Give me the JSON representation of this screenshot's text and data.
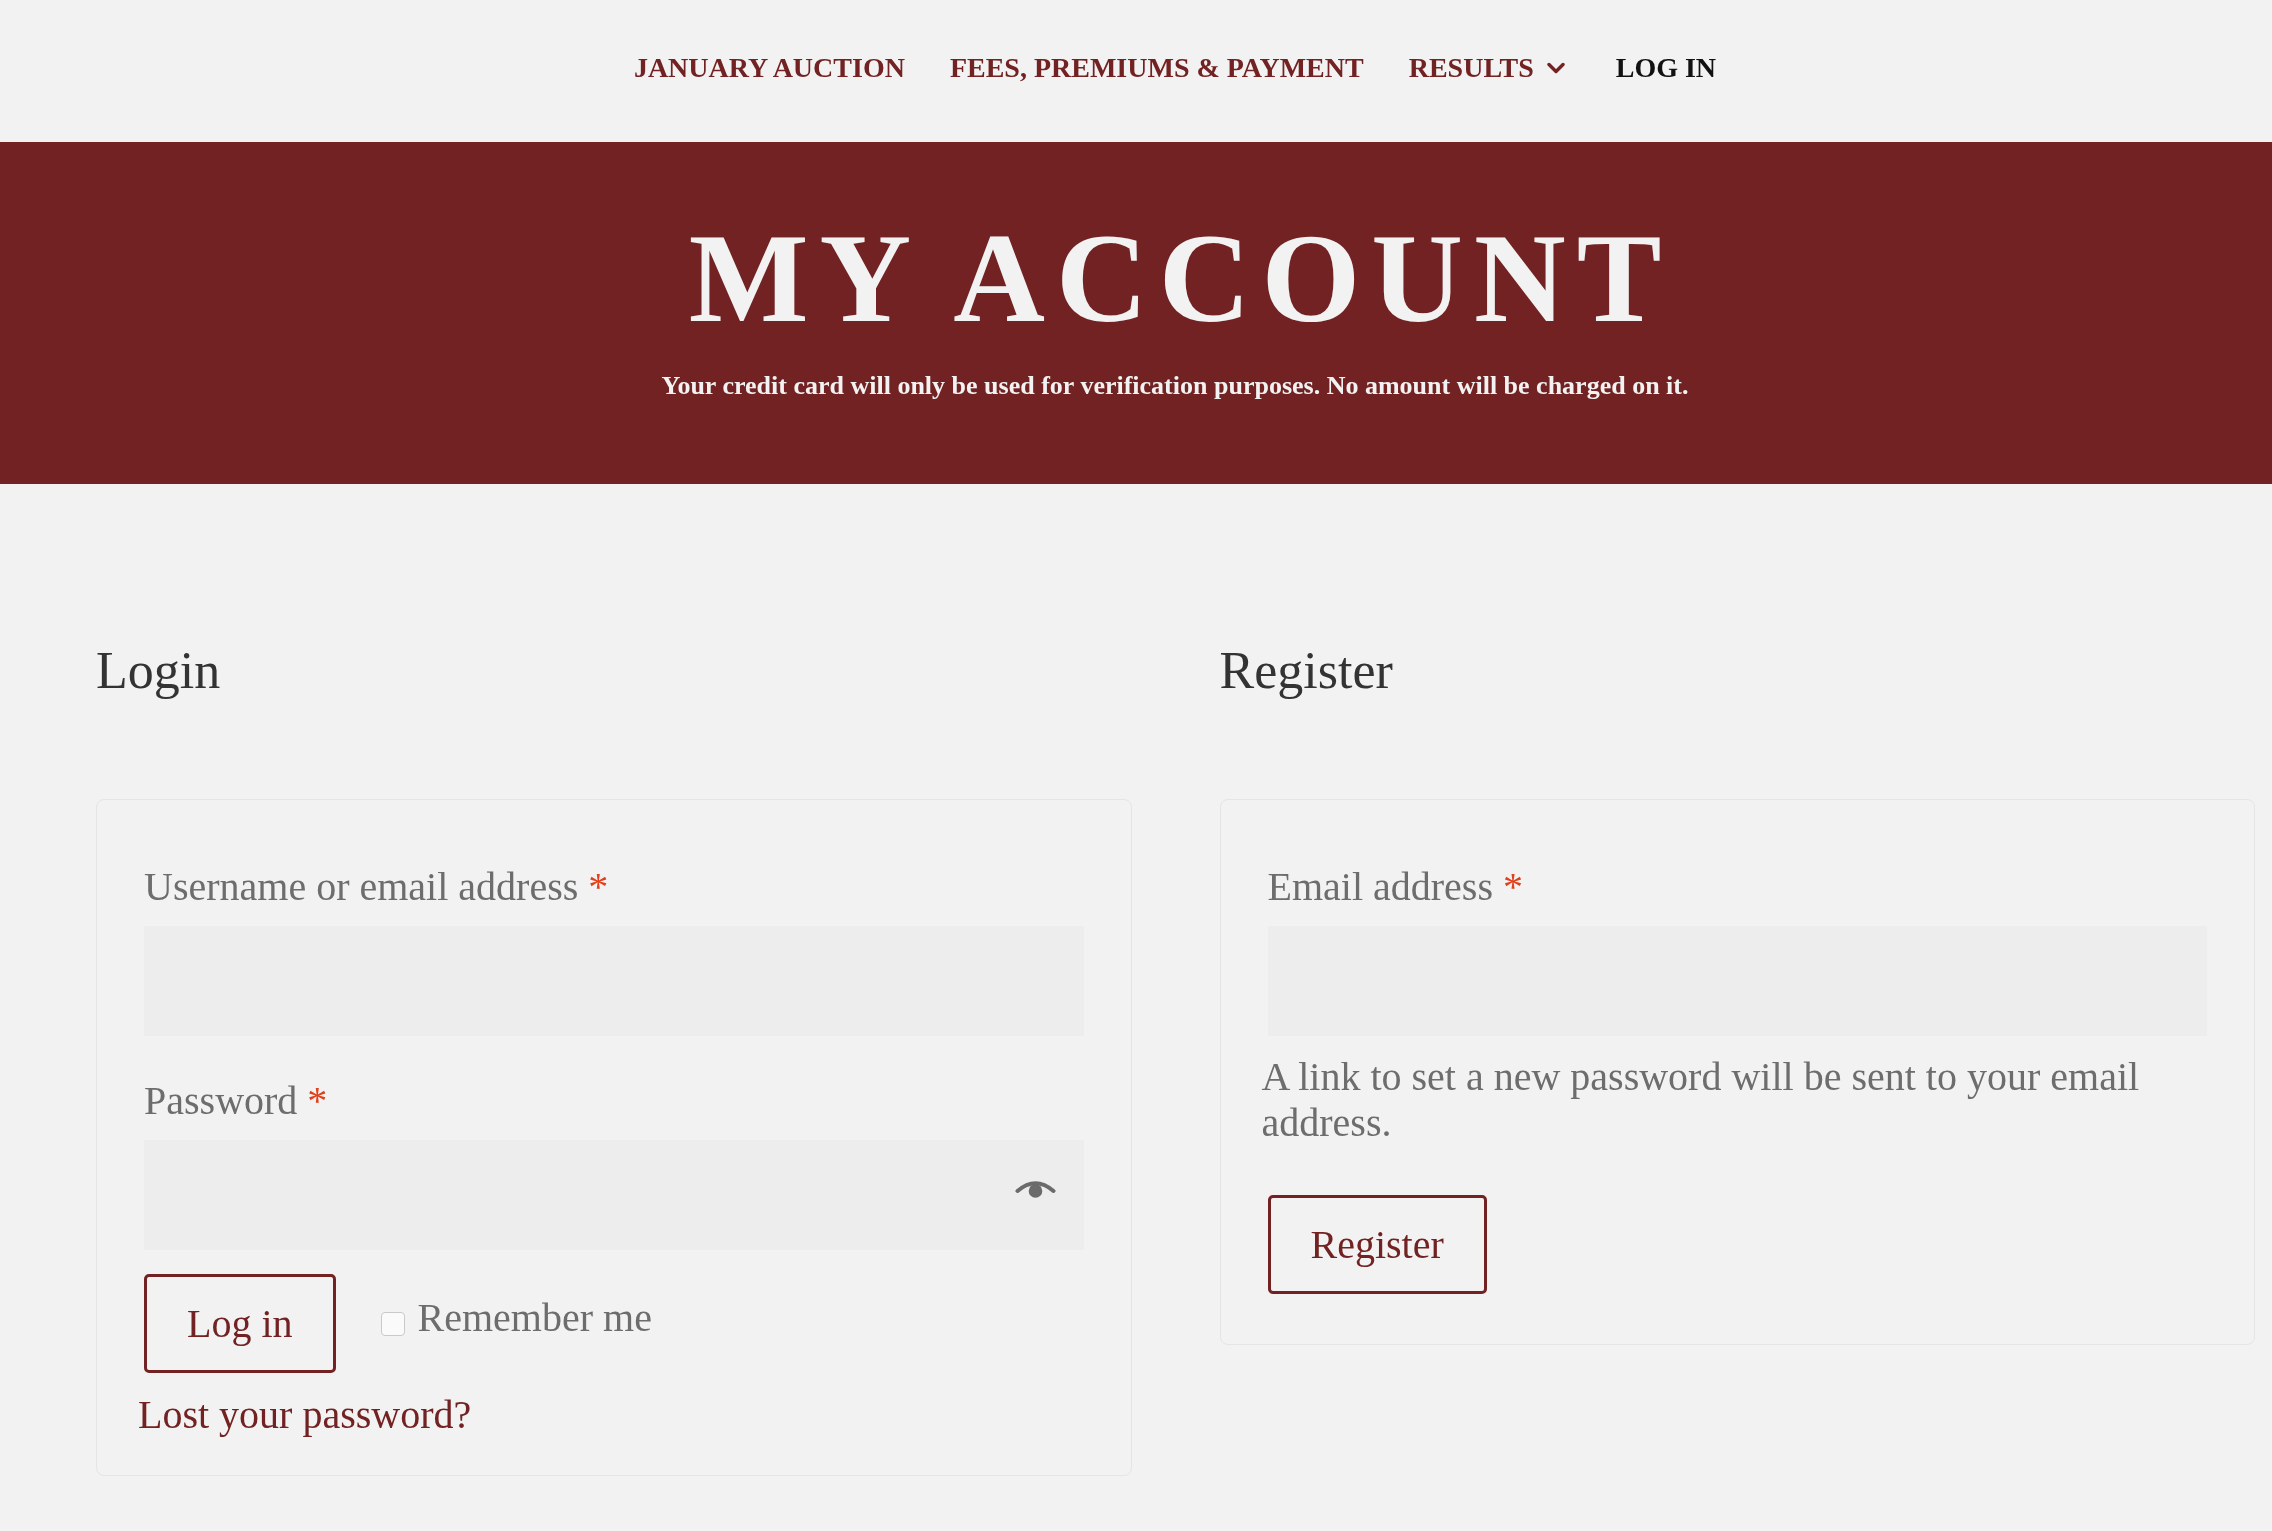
{
  "nav": {
    "items": [
      {
        "label": "JANUARY AUCTION",
        "selected": false,
        "has_submenu": false
      },
      {
        "label": "FEES, PREMIUMS & PAYMENT",
        "selected": false,
        "has_submenu": false
      },
      {
        "label": "RESULTS",
        "selected": false,
        "has_submenu": true
      },
      {
        "label": "LOG IN",
        "selected": true,
        "has_submenu": false
      }
    ]
  },
  "banner": {
    "title": "MY ACCOUNT",
    "subtitle": "Your credit card will only be used for verification purposes. No amount will be charged on it."
  },
  "login": {
    "heading": "Login",
    "fields": [
      {
        "kind": "text",
        "label": "Username or email address",
        "required_mark": "*"
      },
      {
        "kind": "password",
        "label": "Password",
        "required_mark": "*"
      }
    ],
    "submit": "Log in",
    "remember": {
      "label": "Remember me",
      "checked": false
    },
    "lost_password_link": "Lost your password?"
  },
  "register": {
    "heading": "Register",
    "fields": [
      {
        "kind": "email",
        "label": "Email address",
        "required_mark": "*"
      }
    ],
    "note": "A link to set a new password will be sent to your email address.",
    "submit": "Register"
  }
}
